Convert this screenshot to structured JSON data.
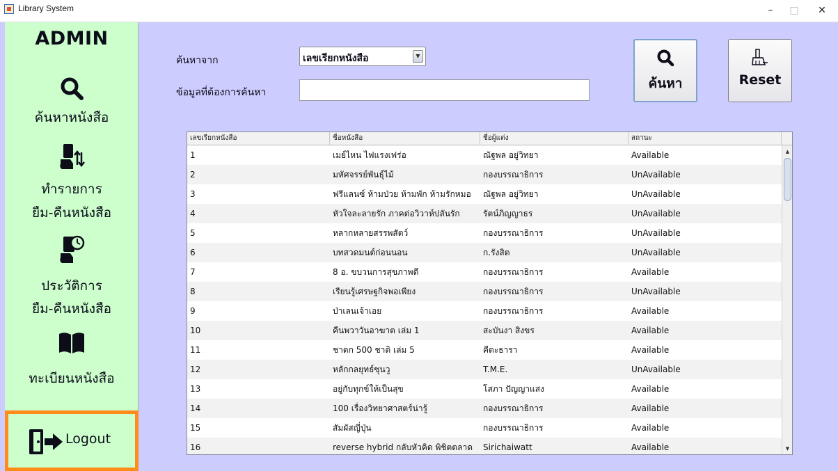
{
  "window": {
    "title": "Library System",
    "controls": {
      "minimize": "–",
      "maximize": "□",
      "close": "✕"
    }
  },
  "sidebar": {
    "brand": "ADMIN",
    "items": [
      {
        "icon": "search-icon",
        "label_lines": [
          "ค้นหาหนังสือ"
        ]
      },
      {
        "icon": "book-transfer-icon",
        "label_lines": [
          "ทำรายการ",
          "ยืม-คืนหนังสือ"
        ]
      },
      {
        "icon": "book-history-icon",
        "label_lines": [
          "ประวัติการ",
          "ยืม-คืนหนังสือ"
        ]
      },
      {
        "icon": "open-book-icon",
        "label_lines": [
          "ทะเบียนหนังสือ"
        ]
      }
    ],
    "logout": {
      "icon": "logout-icon",
      "label": "Logout",
      "highlight_color": "#ff8c1a"
    }
  },
  "search": {
    "from_label": "ค้นหาจาก",
    "data_label": "ข้อมูลที่ต้องการค้นหา",
    "field_selected": "เลขเรียกหนังสือ",
    "query_value": "",
    "search_button": "ค้นหา",
    "reset_button": "Reset"
  },
  "table": {
    "columns": [
      "เลขเรียกหนังสือ",
      "ชื่อหนังสือ",
      "ชื่อผู้แต่ง",
      "สถานะ"
    ],
    "rows": [
      [
        "1",
        "เมย์ไหน ไฟแรงเฟร่อ",
        "ณัฐพล อยู่วิทยา",
        "Available"
      ],
      [
        "2",
        "มหัศจรรย์พันธุ์ไม้",
        "กองบรรณาธิการ",
        "UnAvailable"
      ],
      [
        "3",
        "ฟรีแลนซ์ ห้ามป่วย ห้ามพัก ห้ามรักหมอ",
        "ณัฐพล อยู่วิทยา",
        "UnAvailable"
      ],
      [
        "4",
        "หัวใจละลายรัก ภาคต่อวิวาห์ปลันรัก",
        " รัตน์ภิญญาธร",
        "UnAvailable"
      ],
      [
        "5",
        "หลากหลายสรรพสัตว์",
        "กองบรรณาธิการ",
        "UnAvailable"
      ],
      [
        "6",
        "บทสวดมนต์ก่อนนอน",
        "ก.รังสิต",
        "UnAvailable"
      ],
      [
        "7",
        "8 อ. ขบวนการสุขภาพดี",
        "กองบรรณาธิการ",
        "Available"
      ],
      [
        "8",
        "เรียนรู้เศรษฐกิจพอเพียง",
        "กองบรรณาธิการ",
        "UnAvailable"
      ],
      [
        "9",
        "ป่าเลนเจ้าเอย",
        "กองบรรณาธิการ",
        "Available"
      ],
      [
        "10",
        "คืนพวาวันอาฆาต เล่ม 1",
        "สะบันงา สิงขร",
        "Available"
      ],
      [
        "11",
        "ชาดก 500 ชาติ เล่ม 5",
        "คีตะธารา",
        "Available"
      ],
      [
        "12",
        "หลักกลยุทธ์ซุนวู",
        "T.M.E.",
        "UnAvailable"
      ],
      [
        "13",
        "อยู่กับทุกข์ให้เป็นสุข",
        "โสภา ปัญญาแสง",
        "Available"
      ],
      [
        "14",
        "100 เรื่องวิทยาศาสตร์น่ารู้",
        "กองบรรณาธิการ",
        "Available"
      ],
      [
        "15",
        "สัมผัสญี่ปุ่น",
        "กองบรรณาธิการ",
        "Available"
      ],
      [
        "16",
        "reverse hybrid กลับหัวคิด พิชิตตลาด",
        "Sirichaiwatt",
        "Available"
      ]
    ]
  },
  "colors": {
    "sidebar_bg": "#ccffcc",
    "main_bg": "#ccccff",
    "logout_border": "#ff8c1a"
  }
}
